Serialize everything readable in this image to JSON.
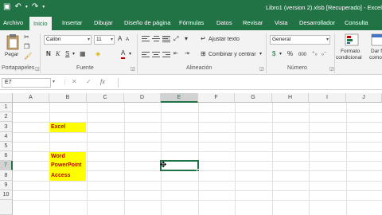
{
  "titlebar": {
    "title": "Libro1 (version 2).xlsb [Recuperado] - Excel",
    "qat": {
      "save_icon": "save-icon",
      "undo_icon": "undo-icon",
      "redo_icon": "redo-icon"
    }
  },
  "tabs": [
    {
      "label": "Archivo"
    },
    {
      "label": "Inicio"
    },
    {
      "label": "Insertar"
    },
    {
      "label": "Dibujar"
    },
    {
      "label": "Diseño de página"
    },
    {
      "label": "Fórmulas"
    },
    {
      "label": "Datos"
    },
    {
      "label": "Revisar"
    },
    {
      "label": "Vista"
    },
    {
      "label": "Desarrollador"
    },
    {
      "label": "Consulta"
    }
  ],
  "ribbon": {
    "clipboard": {
      "paste_label": "Pegar",
      "group_label": "Portapapeles"
    },
    "font": {
      "font_name": "Calibri",
      "font_size": "11",
      "group_label": "Fuente",
      "bold": "N",
      "italic": "K",
      "underline": "S",
      "font_color_glyph": "A",
      "grow": "A",
      "shrink": "A"
    },
    "alignment": {
      "wrap_text": "Ajustar texto",
      "merge_center": "Combinar y centrar",
      "group_label": "Alineación"
    },
    "number": {
      "format": "General",
      "currency": "$",
      "percent": "%",
      "comma": "000",
      "group_label": "Número"
    },
    "styles": {
      "conditional_format": "Formato condicional",
      "conditional_format_line1": "Formato",
      "conditional_format_line2": "condicional",
      "format_table": "Dar f",
      "format_table_line2": "como t"
    }
  },
  "formula_bar": {
    "name_box": "E7",
    "cancel": "✕",
    "enter": "✓",
    "fx": "fx",
    "formula": ""
  },
  "grid": {
    "columns": [
      "A",
      "B",
      "C",
      "D",
      "E",
      "F",
      "G",
      "H",
      "I",
      "J"
    ],
    "rows": [
      "1",
      "2",
      "3",
      "4",
      "5",
      "6",
      "7",
      "8",
      "9",
      "10"
    ],
    "selected_column": "E",
    "selected_row": "7",
    "cells": {
      "B3": "Excel",
      "B6": "Word",
      "B7": "PowerPoint",
      "B8": "Access"
    },
    "text_color": "#c00000",
    "fill_color": "#ffff00"
  },
  "colors": {
    "brand": "#217346",
    "ribbon_bg": "#f3f3f3"
  }
}
